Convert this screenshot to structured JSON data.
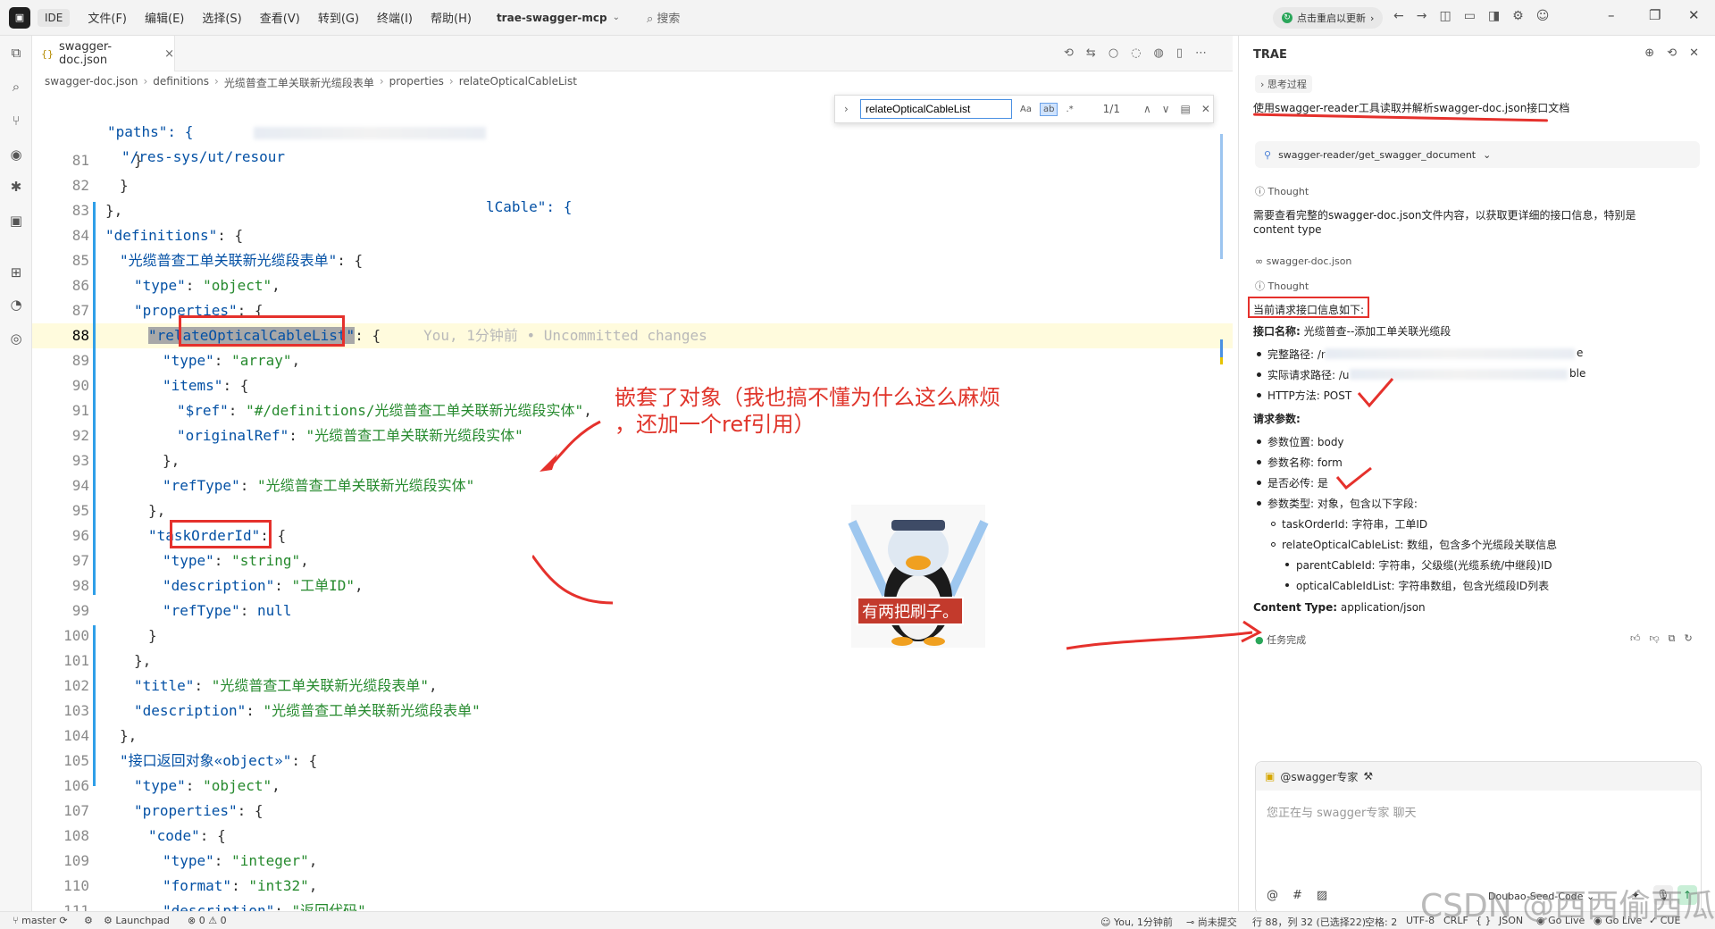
{
  "titlebar": {
    "ide_label": "IDE",
    "menu": [
      "文件(F)",
      "编辑(E)",
      "选择(S)",
      "查看(V)",
      "转到(G)",
      "终端(I)",
      "帮助(H)"
    ],
    "project": "trae-swagger-mcp",
    "search": "搜索",
    "update_label": "点击重启以更新"
  },
  "editor": {
    "tab_label": "swagger-doc.json",
    "breadcrumb": [
      "swagger-doc.json",
      "definitions",
      "光缆普查工单关联新光缆段表单",
      "properties",
      "relateOpticalCableList"
    ],
    "find": {
      "query": "relateOpticalCableList",
      "opt_case": "Aa",
      "opt_word": "ab",
      "opt_regex": ".*",
      "count": "1/1"
    },
    "sticky": [
      {
        "text_key": "\"paths\": {",
        "indent": 1
      },
      {
        "path_start": "\"/res-sys/ut/resour",
        "path_end": "lCable\": {"
      }
    ],
    "lines": [
      {
        "n": "81",
        "t": "}"
      },
      {
        "n": "82",
        "t": "}"
      },
      {
        "n": "83",
        "t": "},"
      },
      {
        "n": "84",
        "k": "\"definitions\"",
        "r": ": {"
      },
      {
        "n": "85",
        "k": "\"光缆普查工单关联新光缆段表单\"",
        "r": ": {"
      },
      {
        "n": "86",
        "k": "\"type\"",
        "r": ": ",
        "s": "\"object\"",
        "e": ","
      },
      {
        "n": "87",
        "k": "\"properties\"",
        "r": ": {"
      },
      {
        "n": "88",
        "k": "\"relateOpticalCableList\"",
        "r": ": {"
      },
      {
        "n": "89",
        "k": "\"type\"",
        "r": ": ",
        "s": "\"array\"",
        "e": ","
      },
      {
        "n": "90",
        "k": "\"items\"",
        "r": ": {"
      },
      {
        "n": "91",
        "k": "\"$ref\"",
        "r": ": ",
        "s": "\"#/definitions/光缆普查工单关联新光缆段实体\"",
        "e": ","
      },
      {
        "n": "92",
        "k": "\"originalRef\"",
        "r": ": ",
        "s": "\"光缆普查工单关联新光缆段实体\"",
        "e": ""
      },
      {
        "n": "93",
        "t": "},"
      },
      {
        "n": "94",
        "k": "\"refType\"",
        "r": ": ",
        "s": "\"光缆普查工单关联新光缆段实体\"",
        "e": ""
      },
      {
        "n": "95",
        "t": "},"
      },
      {
        "n": "96",
        "k": "\"taskOrderId\"",
        "r": ": {"
      },
      {
        "n": "97",
        "k": "\"type\"",
        "r": ": ",
        "s": "\"string\"",
        "e": ","
      },
      {
        "n": "98",
        "k": "\"description\"",
        "r": ": ",
        "s": "\"工单ID\"",
        "e": ","
      },
      {
        "n": "99",
        "k": "\"refType\"",
        "r": ": ",
        "s": "null",
        "e": ""
      },
      {
        "n": "100",
        "t": "}"
      },
      {
        "n": "101",
        "t": "},"
      },
      {
        "n": "102",
        "k": "\"title\"",
        "r": ": ",
        "s": "\"光缆普查工单关联新光缆段表单\"",
        "e": ","
      },
      {
        "n": "103",
        "k": "\"description\"",
        "r": ": ",
        "s": "\"光缆普查工单关联新光缆段表单\"",
        "e": ""
      },
      {
        "n": "104",
        "t": "},"
      },
      {
        "n": "105",
        "k": "\"接口返回对象«object»\"",
        "r": ": {"
      },
      {
        "n": "106",
        "k": "\"type\"",
        "r": ": ",
        "s": "\"object\"",
        "e": ","
      },
      {
        "n": "107",
        "k": "\"properties\"",
        "r": ": {"
      },
      {
        "n": "108",
        "k": "\"code\"",
        "r": ": {"
      },
      {
        "n": "109",
        "k": "\"type\"",
        "r": ": ",
        "s": "\"integer\"",
        "e": ","
      },
      {
        "n": "110",
        "k": "\"format\"",
        "r": ": ",
        "s": "\"int32\"",
        "e": ","
      },
      {
        "n": "111",
        "k": "\"description\"",
        "r": ": ",
        "s": "\"返回代码\"",
        "e": ","
      }
    ],
    "blame": "You, 1分钟前 • Uncommitted changes",
    "annotation": [
      "嵌套了对象（我也搞不懂为什么这么麻烦",
      "，还加一个ref引用）"
    ],
    "sticker_caption": "有两把刷子。"
  },
  "chat": {
    "title": "TRAE",
    "thinking_label": "思考过程",
    "user_msg": "使用swagger-reader工具读取并解析swagger-doc.json接口文档",
    "tool_call": "swagger-reader/get_swagger_document",
    "thought1": "Thought",
    "thought_text": [
      "需要查看完整的swagger-doc.json文件内容，以获取更详细的接口信息，特别是",
      "content type"
    ],
    "file_ref": "swagger-doc.json",
    "thought2": "Thought",
    "current_info": "当前请求接口信息如下:",
    "api_name_label": "接口名称:",
    "api_name": "光缆普查--添加工单关联光缆段",
    "bullets_path": [
      {
        "label": "完整路径: /r",
        "tail": "e"
      },
      {
        "label": "实际请求路径: /u",
        "tail": "ble"
      },
      {
        "label": "HTTP方法: POST",
        "tail": ""
      }
    ],
    "req_params_label": "请求参数:",
    "params": [
      "参数位置: body",
      "参数名称: form",
      "是否必传: 是",
      "参数类型: 对象，包含以下字段:"
    ],
    "sub_fields": [
      "taskOrderId: 字符串，工单ID",
      "relateOpticalCableList: 数组，包含多个光缆段关联信息"
    ],
    "sub_sub_fields": [
      "parentCableId: 字符串，父级缆(光缆系统/中继段)ID",
      "opticalCableIdList: 字符串数组，包含光缆段ID列表"
    ],
    "content_type_label": "Content Type:",
    "content_type": "application/json",
    "task_done": "任务完成",
    "agent": "@swagger专家",
    "input_placeholder": "您正在与 swagger专家 聊天",
    "model": "Doubao-Seed-Code"
  },
  "statusbar": {
    "branch": "master",
    "launchpad": "Launchpad",
    "errors": "0",
    "warnings": "0",
    "blame": "You, 1分钟前",
    "uncommitted": "尚未提交",
    "position": "行 88，列 32 (已选择22)",
    "spaces": "空格: 2",
    "encoding": "UTF-8",
    "eol": "CRLF",
    "lang_braces": "{ }",
    "lang": "JSON",
    "golive1": "Go Live",
    "golive2": "Go Live",
    "cue": "CUE"
  },
  "watermark": "CSDN @西西偷西瓜"
}
